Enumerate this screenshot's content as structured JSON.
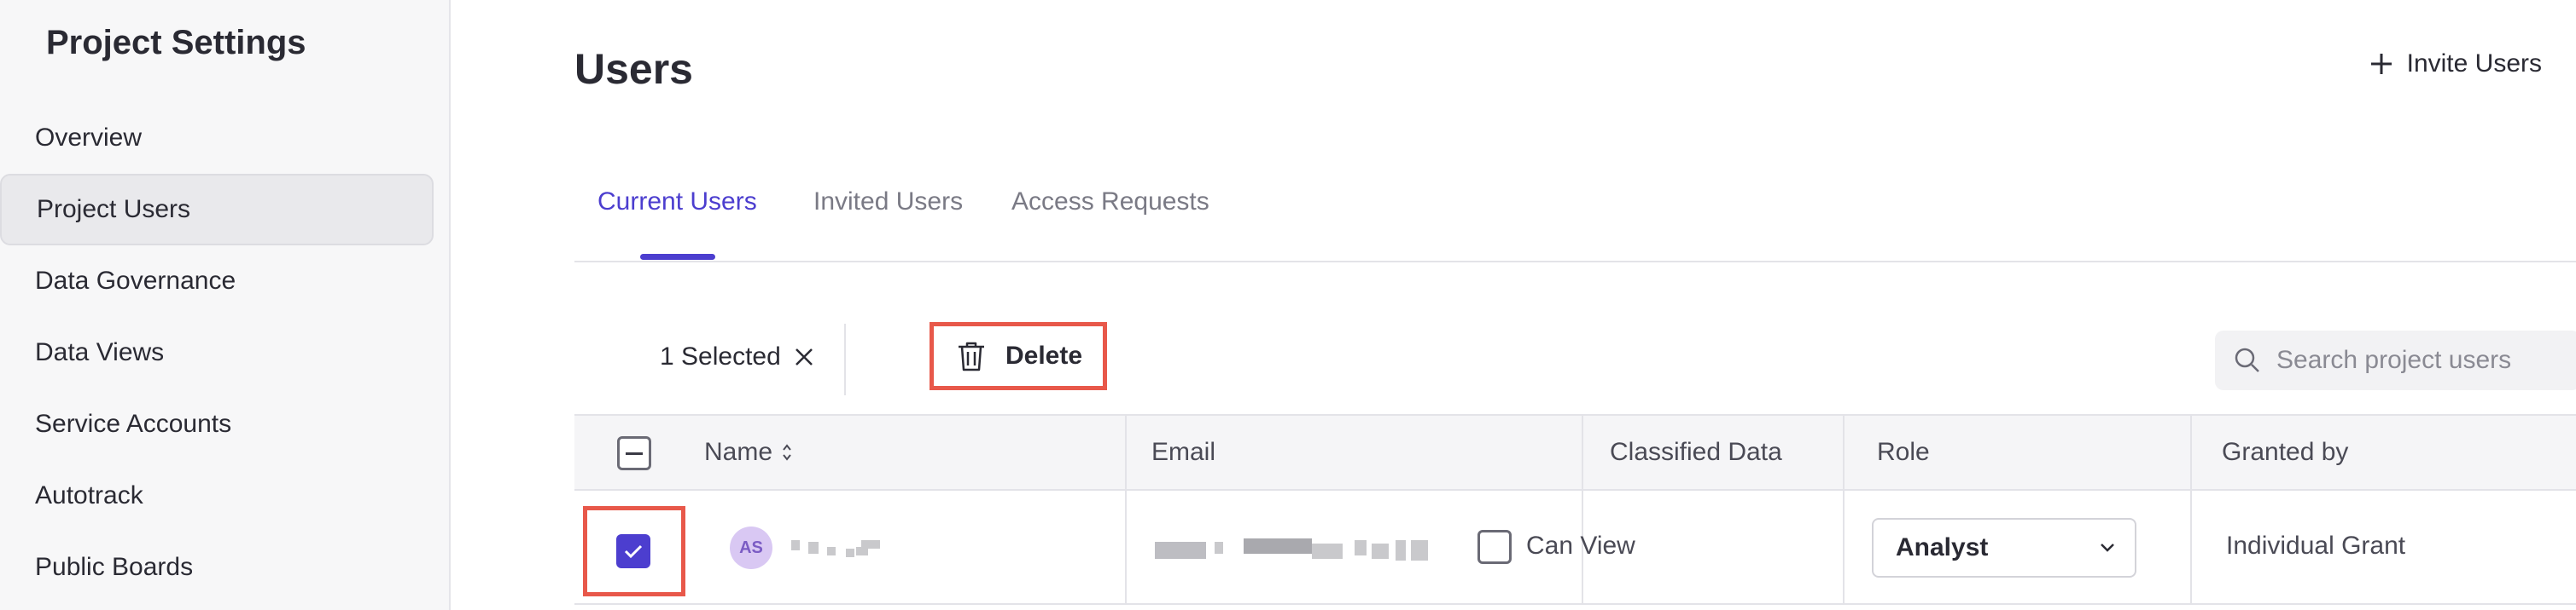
{
  "sidebar": {
    "title": "Project Settings",
    "items": [
      {
        "label": "Overview",
        "active": false
      },
      {
        "label": "Project Users",
        "active": true
      },
      {
        "label": "Data Governance",
        "active": false
      },
      {
        "label": "Data Views",
        "active": false
      },
      {
        "label": "Service Accounts",
        "active": false
      },
      {
        "label": "Autotrack",
        "active": false
      },
      {
        "label": "Public Boards",
        "active": false
      }
    ]
  },
  "header": {
    "title": "Users",
    "invite_label": "Invite Users"
  },
  "tabs": [
    {
      "label": "Current Users",
      "active": true
    },
    {
      "label": "Invited Users",
      "active": false
    },
    {
      "label": "Access Requests",
      "active": false
    }
  ],
  "selection": {
    "count_label": "1 Selected",
    "delete_label": "Delete"
  },
  "search": {
    "placeholder": "Search project users"
  },
  "table": {
    "columns": [
      "Name",
      "Email",
      "Classified Data",
      "Role",
      "Granted by"
    ],
    "rows": [
      {
        "avatar_initials": "AS",
        "selected": true,
        "classified_label": "Can View",
        "classified_checked": false,
        "role": "Analyst",
        "granted_by": "Individual Grant"
      }
    ]
  },
  "colors": {
    "accent": "#4c3ecf",
    "highlight": "#e8584a",
    "sidebar_bg": "#f7f7f8"
  },
  "icons": {
    "invite": "plus-icon",
    "clear_selection": "close-icon",
    "delete": "trash-icon",
    "search": "search-icon",
    "sort": "sort-icon",
    "role_dropdown": "chevron-down-icon"
  }
}
